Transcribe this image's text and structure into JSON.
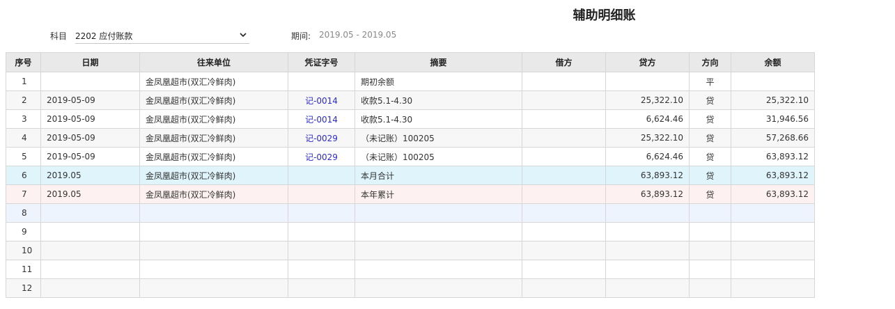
{
  "page": {
    "title": "辅助明细账"
  },
  "filters": {
    "subject_label": "科目",
    "subject_value": "2202 应付账款",
    "period_label": "期间:",
    "period_value": "2019.05 - 2019.05"
  },
  "table": {
    "headers": [
      "序号",
      "日期",
      "往来单位",
      "凭证字号",
      "摘要",
      "借方",
      "贷方",
      "方向",
      "余额"
    ],
    "rows": [
      {
        "seq": "1",
        "date": "",
        "unit": "金凤凰超市(双汇冷鲜肉)",
        "voucher": "",
        "summary": "期初余额",
        "debit": "",
        "credit": "",
        "dir": "平",
        "balance": ""
      },
      {
        "seq": "2",
        "date": "2019-05-09",
        "unit": "金凤凰超市(双汇冷鲜肉)",
        "voucher": "记-0014",
        "summary": "收款5.1-4.30",
        "debit": "",
        "credit": "25,322.10",
        "dir": "贷",
        "balance": "25,322.10"
      },
      {
        "seq": "3",
        "date": "2019-05-09",
        "unit": "金凤凰超市(双汇冷鲜肉)",
        "voucher": "记-0014",
        "summary": "收款5.1-4.30",
        "debit": "",
        "credit": "6,624.46",
        "dir": "贷",
        "balance": "31,946.56"
      },
      {
        "seq": "4",
        "date": "2019-05-09",
        "unit": "金凤凰超市(双汇冷鲜肉)",
        "voucher": "记-0029",
        "summary": "（未记账）100205",
        "debit": "",
        "credit": "25,322.10",
        "dir": "贷",
        "balance": "57,268.66"
      },
      {
        "seq": "5",
        "date": "2019-05-09",
        "unit": "金凤凰超市(双汇冷鲜肉)",
        "voucher": "记-0029",
        "summary": "（未记账）100205",
        "debit": "",
        "credit": "6,624.46",
        "dir": "贷",
        "balance": "63,893.12"
      },
      {
        "seq": "6",
        "date": "2019.05",
        "unit": "金凤凰超市(双汇冷鲜肉)",
        "voucher": "",
        "summary": "本月合计",
        "debit": "",
        "credit": "63,893.12",
        "dir": "贷",
        "balance": "63,893.12"
      },
      {
        "seq": "7",
        "date": "2019.05",
        "unit": "金凤凰超市(双汇冷鲜肉)",
        "voucher": "",
        "summary": "本年累计",
        "debit": "",
        "credit": "63,893.12",
        "dir": "贷",
        "balance": "63,893.12"
      },
      {
        "seq": "8",
        "date": "",
        "unit": "",
        "voucher": "",
        "summary": "",
        "debit": "",
        "credit": "",
        "dir": "",
        "balance": ""
      },
      {
        "seq": "9",
        "date": "",
        "unit": "",
        "voucher": "",
        "summary": "",
        "debit": "",
        "credit": "",
        "dir": "",
        "balance": ""
      },
      {
        "seq": "10",
        "date": "",
        "unit": "",
        "voucher": "",
        "summary": "",
        "debit": "",
        "credit": "",
        "dir": "",
        "balance": ""
      },
      {
        "seq": "11",
        "date": "",
        "unit": "",
        "voucher": "",
        "summary": "",
        "debit": "",
        "credit": "",
        "dir": "",
        "balance": ""
      },
      {
        "seq": "12",
        "date": "",
        "unit": "",
        "voucher": "",
        "summary": "",
        "debit": "",
        "credit": "",
        "dir": "",
        "balance": ""
      }
    ]
  },
  "colors": {
    "voucher_link": "#2a2ad4",
    "month_total_row": "#dff4fb",
    "year_total_row": "#fdf1f1",
    "selected_row": "#eef4fd",
    "header_bg": "#e9e9e9"
  },
  "icons": {
    "subject_dropdown": "chevron-down-icon"
  }
}
